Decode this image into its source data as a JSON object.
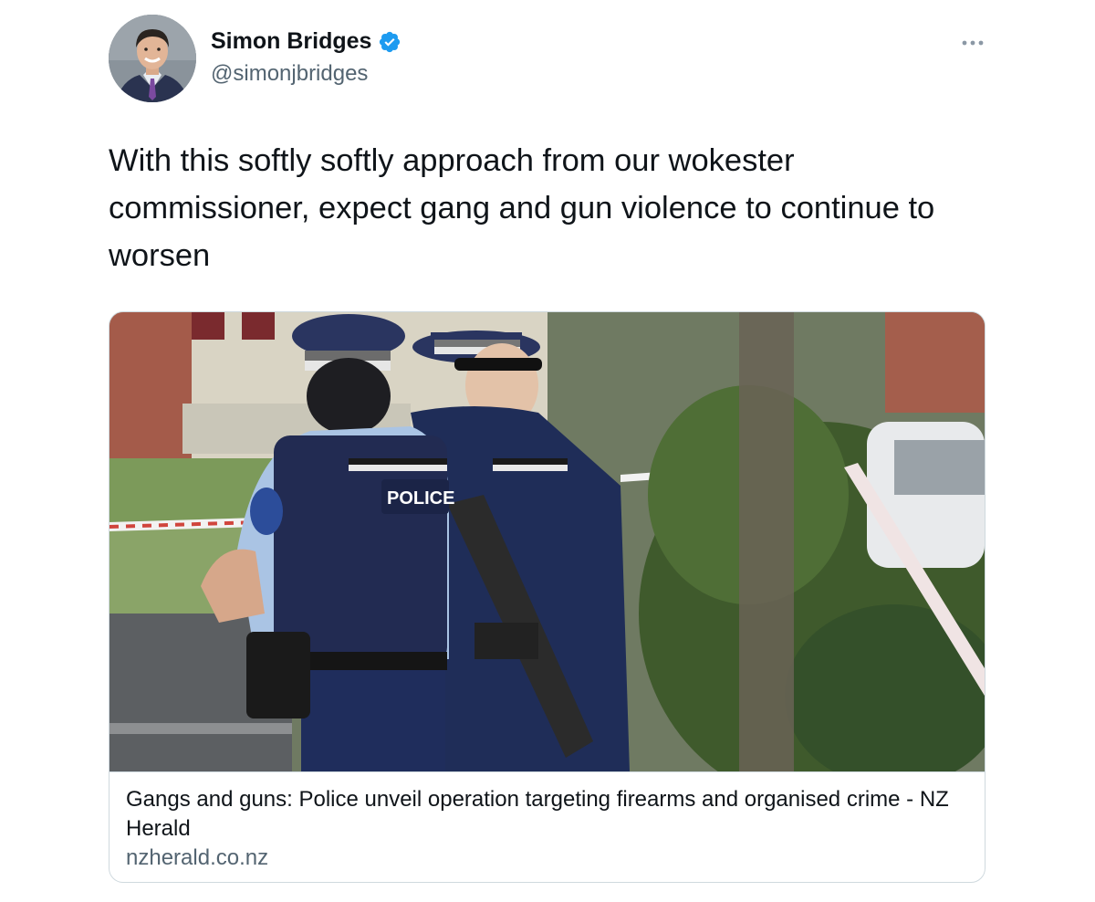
{
  "author": {
    "name": "Simon Bridges",
    "handle": "@simonjbridges",
    "verified": true
  },
  "tweet": {
    "text": "With this softly softly approach from our wokester commissioner, expect gang and gun violence to continue to worsen"
  },
  "card": {
    "title": "Gangs and guns: Police unveil operation targeting firearms and organised crime - NZ Herald",
    "domain": "nzherald.co.nz",
    "image_vest_text": "POLICE"
  },
  "icons": {
    "verified": "verified-badge-icon",
    "more": "more-options-icon"
  },
  "colors": {
    "verified_blue": "#1d9bf0",
    "secondary_text": "#536471",
    "border": "#cfd9de"
  }
}
